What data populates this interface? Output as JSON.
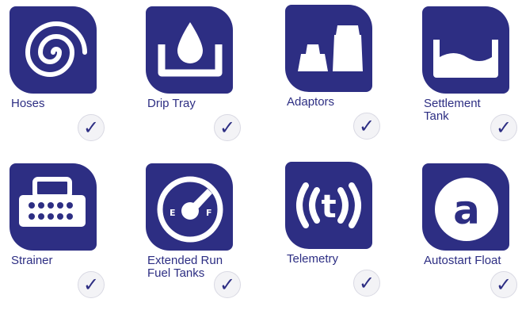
{
  "items": [
    {
      "label": "Hoses",
      "icon": "hose-coil-icon",
      "checked": true
    },
    {
      "label": "Drip Tray",
      "icon": "drip-tray-icon",
      "checked": true
    },
    {
      "label": "Adaptors",
      "icon": "adaptors-icon",
      "checked": true
    },
    {
      "label": "Settlement Tank",
      "icon": "settlement-tank-icon",
      "checked": true
    },
    {
      "label": "Strainer",
      "icon": "strainer-icon",
      "checked": true
    },
    {
      "label": "Extended Run Fuel Tanks",
      "icon": "fuel-gauge-icon",
      "checked": true
    },
    {
      "label": "Telemetry",
      "icon": "telemetry-icon",
      "checked": true
    },
    {
      "label": "Autostart Float",
      "icon": "autostart-float-icon",
      "checked": true
    }
  ],
  "check_glyph": "✓",
  "colors": {
    "tile": "#2d2e83",
    "label": "#2d2e83",
    "check_bg": "#f3f3f6"
  },
  "icon_texts": {
    "gauge_empty": "E",
    "gauge_full": "F",
    "telemetry_letter": "t",
    "float_letter": "a"
  }
}
